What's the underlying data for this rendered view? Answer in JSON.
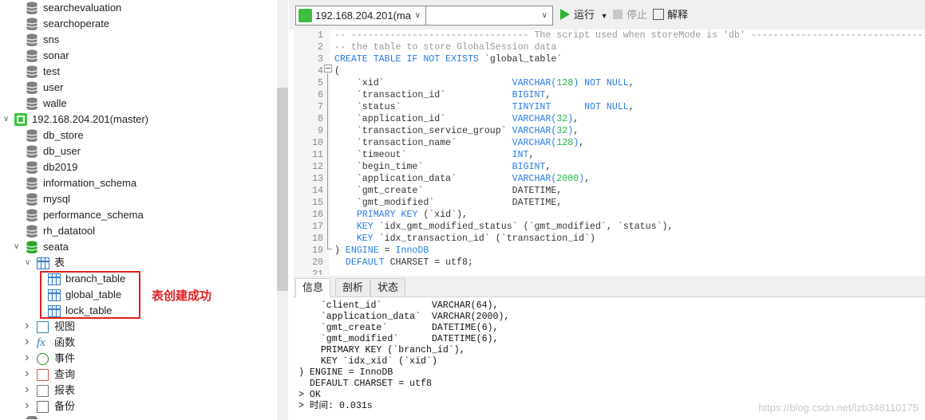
{
  "tree": {
    "databases_top": [
      "searchevaluation",
      "searchoperate",
      "sns",
      "sonar",
      "test",
      "user",
      "walle"
    ],
    "server": {
      "label": "192.168.204.201(master)",
      "icon": "server-connected-icon"
    },
    "server_databases": [
      "db_store",
      "db_user",
      "db2019",
      "information_schema",
      "mysql",
      "performance_schema",
      "rh_datatool"
    ],
    "active_db": "seata",
    "tables_folder": "表",
    "tables": [
      "branch_table",
      "global_table",
      "lock_table"
    ],
    "folders": [
      {
        "label": "视图",
        "icon": "view-icon"
      },
      {
        "label": "函数",
        "icon": "function-icon"
      },
      {
        "label": "事件",
        "icon": "event-clock-icon"
      },
      {
        "label": "查询",
        "icon": "query-icon"
      },
      {
        "label": "报表",
        "icon": "report-icon"
      },
      {
        "label": "备份",
        "icon": "backup-icon"
      }
    ]
  },
  "annotation": {
    "text": "表创建成功",
    "color": "#e02020"
  },
  "toolbar": {
    "connection": "192.168.204.201(ma",
    "database": "",
    "run": "运行",
    "stop": "停止",
    "explain": "解释"
  },
  "editor": {
    "lines": [
      [
        [
          "-- -------------------------------- The script used when storeMode is 'db' --------------------------------",
          "c"
        ]
      ],
      [
        [
          "-- the table to store GlobalSession data",
          "c"
        ]
      ],
      [
        [
          "CREATE TABLE IF NOT EXISTS ",
          "k"
        ],
        [
          "`global_table`",
          "p"
        ]
      ],
      [
        [
          "(",
          "p"
        ]
      ],
      [
        [
          "    `xid`                       ",
          "p"
        ],
        [
          "VARCHAR(",
          "k"
        ],
        [
          "128",
          "n"
        ],
        [
          ") NOT NULL",
          "k"
        ],
        [
          ",",
          "p"
        ]
      ],
      [
        [
          "    `transaction_id`            ",
          "p"
        ],
        [
          "BIGINT",
          "k"
        ],
        [
          ",",
          "p"
        ]
      ],
      [
        [
          "    `status`                    ",
          "p"
        ],
        [
          "TINYINT      NOT NULL",
          "k"
        ],
        [
          ",",
          "p"
        ]
      ],
      [
        [
          "    `application_id`            ",
          "p"
        ],
        [
          "VARCHAR(",
          "k"
        ],
        [
          "32",
          "n"
        ],
        [
          ")",
          "k"
        ],
        [
          ",",
          "p"
        ]
      ],
      [
        [
          "    `transaction_service_group` ",
          "p"
        ],
        [
          "VARCHAR(",
          "k"
        ],
        [
          "32",
          "n"
        ],
        [
          ")",
          "k"
        ],
        [
          ",",
          "p"
        ]
      ],
      [
        [
          "    `transaction_name`          ",
          "p"
        ],
        [
          "VARCHAR(",
          "k"
        ],
        [
          "128",
          "n"
        ],
        [
          ")",
          "k"
        ],
        [
          ",",
          "p"
        ]
      ],
      [
        [
          "    `timeout`                   ",
          "p"
        ],
        [
          "INT",
          "k"
        ],
        [
          ",",
          "p"
        ]
      ],
      [
        [
          "    `begin_time`                ",
          "p"
        ],
        [
          "BIGINT",
          "k"
        ],
        [
          ",",
          "p"
        ]
      ],
      [
        [
          "    `application_data`          ",
          "p"
        ],
        [
          "VARCHAR(",
          "k"
        ],
        [
          "2000",
          "n"
        ],
        [
          ")",
          "k"
        ],
        [
          ",",
          "p"
        ]
      ],
      [
        [
          "    `gmt_create`                DATETIME,",
          "p"
        ]
      ],
      [
        [
          "    `gmt_modified`              DATETIME,",
          "p"
        ]
      ],
      [
        [
          "    PRIMARY KEY ",
          "k"
        ],
        [
          "(`xid`),",
          "p"
        ]
      ],
      [
        [
          "    KEY ",
          "k"
        ],
        [
          "`idx_gmt_modified_status` (`gmt_modified`, `status`),",
          "p"
        ]
      ],
      [
        [
          "    KEY ",
          "k"
        ],
        [
          "`idx_transaction_id` (`transaction_id`)",
          "p"
        ]
      ],
      [
        [
          ") ",
          "p"
        ],
        [
          "ENGINE",
          "k"
        ],
        [
          " = ",
          "p"
        ],
        [
          "InnoDB",
          "k"
        ]
      ],
      [
        [
          "  DEFAULT",
          "k"
        ],
        [
          " CHARSET = utf8;",
          "p"
        ]
      ],
      [
        [
          "",
          "p"
        ]
      ]
    ]
  },
  "tabs": [
    "信息",
    "剖析",
    "状态"
  ],
  "output": [
    "    `client_id`         VARCHAR(64),",
    "    `application_data`  VARCHAR(2000),",
    "    `gmt_create`        DATETIME(6),",
    "    `gmt_modified`      DATETIME(6),",
    "    PRIMARY KEY (`branch_id`),",
    "    KEY `idx_xid` (`xid`)",
    ") ENGINE = InnoDB",
    "  DEFAULT CHARSET = utf8",
    "> OK",
    "> 时间: 0.031s"
  ],
  "watermark": "https://blog.csdn.net/lzb348110175"
}
